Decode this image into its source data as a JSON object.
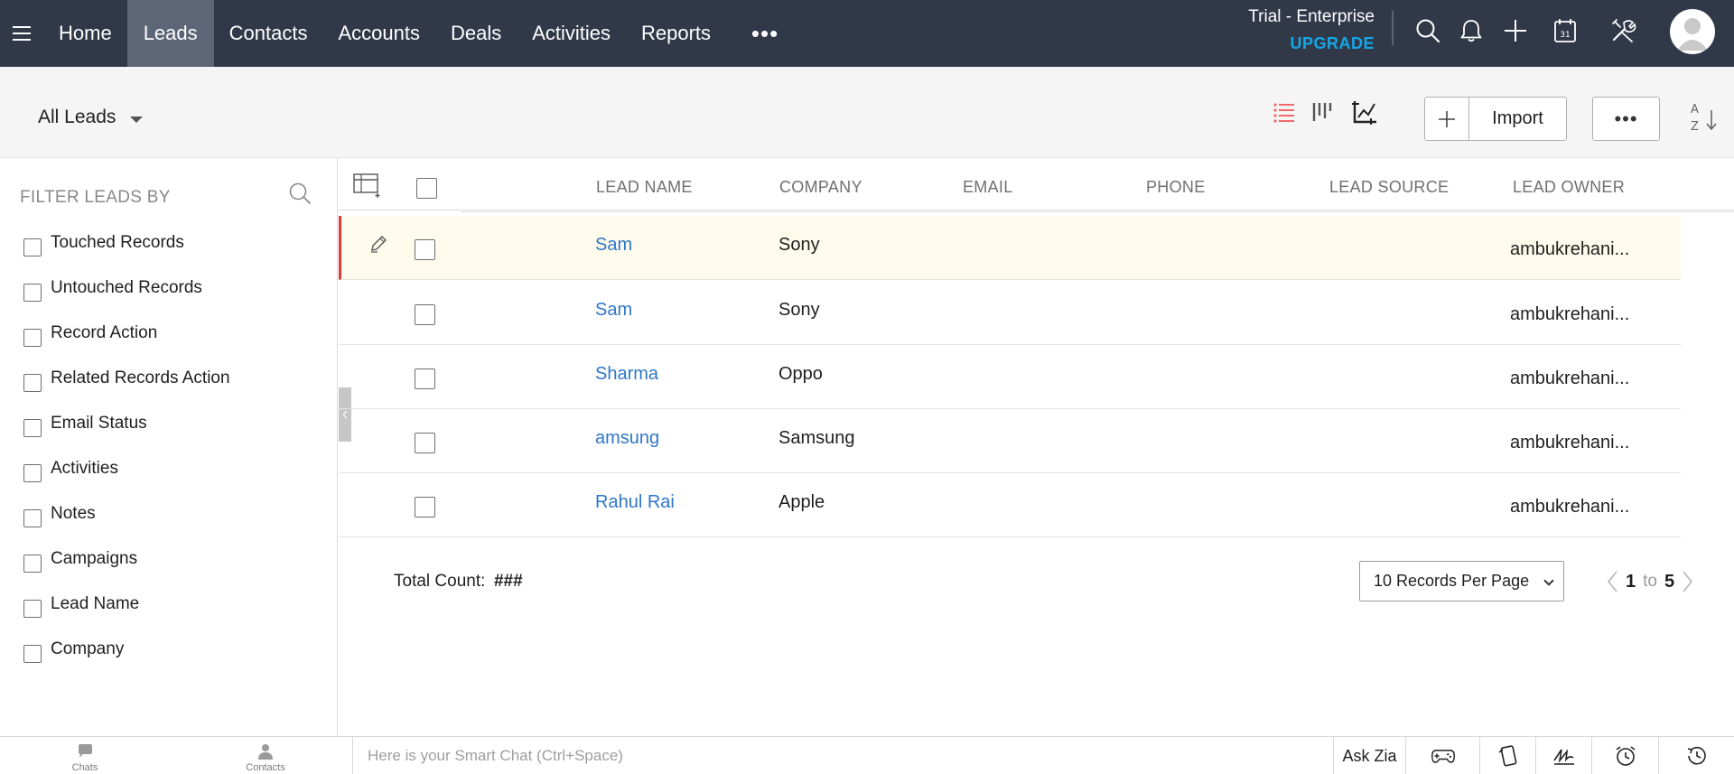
{
  "nav": {
    "tabs": [
      {
        "label": "Home"
      },
      {
        "label": "Leads"
      },
      {
        "label": "Contacts"
      },
      {
        "label": "Accounts"
      },
      {
        "label": "Deals"
      },
      {
        "label": "Activities"
      },
      {
        "label": "Reports"
      }
    ],
    "active_tab": "Leads",
    "more_label": "•••",
    "trial_text": "Trial - Enterprise",
    "upgrade_label": "UPGRADE",
    "calendar_day": "31",
    "icons": [
      "menu-icon",
      "search-icon",
      "bell-icon",
      "plus-icon",
      "calendar-icon",
      "tools-icon",
      "avatar"
    ]
  },
  "subheader": {
    "view_label": "All Leads",
    "import_label": "Import",
    "more_label": "•••",
    "icons": [
      "list-view-icon",
      "kanban-view-icon",
      "chart-view-icon",
      "plus-icon",
      "sort-icon"
    ]
  },
  "filters": {
    "title": "FILTER LEADS BY",
    "items": [
      {
        "label": "Touched Records"
      },
      {
        "label": "Untouched Records"
      },
      {
        "label": "Record Action"
      },
      {
        "label": "Related Records Action"
      },
      {
        "label": "Email Status"
      },
      {
        "label": "Activities"
      },
      {
        "label": "Notes"
      },
      {
        "label": "Campaigns"
      },
      {
        "label": "Lead Name"
      },
      {
        "label": "Company"
      }
    ]
  },
  "table": {
    "columns": [
      "LEAD NAME",
      "COMPANY",
      "EMAIL",
      "PHONE",
      "LEAD SOURCE",
      "LEAD OWNER"
    ],
    "rows": [
      {
        "lead_name": "Sam",
        "company": "Sony",
        "email": "",
        "phone": "",
        "lead_source": "",
        "lead_owner": "ambukrehani..."
      },
      {
        "lead_name": "Sam",
        "company": "Sony",
        "email": "",
        "phone": "",
        "lead_source": "",
        "lead_owner": "ambukrehani..."
      },
      {
        "lead_name": "Sharma",
        "company": "Oppo",
        "email": "",
        "phone": "",
        "lead_source": "",
        "lead_owner": "ambukrehani..."
      },
      {
        "lead_name": "amsung",
        "company": "Samsung",
        "email": "",
        "phone": "",
        "lead_source": "",
        "lead_owner": "ambukrehani..."
      },
      {
        "lead_name": "Rahul Rai",
        "company": "Apple",
        "email": "",
        "phone": "",
        "lead_source": "",
        "lead_owner": "ambukrehani..."
      }
    ],
    "highlighted_row": 1
  },
  "footer": {
    "total_label": "Total Count:",
    "total_value": "###",
    "per_page": "10 Records Per Page",
    "page_from": "1",
    "page_to_label": "to",
    "page_to": "5"
  },
  "bottombar": {
    "chats_label": "Chats",
    "contacts_label": "Contacts",
    "smartchat_placeholder": "Here is your Smart Chat (Ctrl+Space)",
    "askzia_label": "Ask Zia",
    "icons": [
      "chat-icon",
      "contact-icon",
      "gamepad-icon",
      "phone-icon",
      "signature-icon",
      "alarm-icon",
      "history-icon"
    ]
  },
  "colors": {
    "nav_bg": "#313949",
    "nav_active": "#5d6677",
    "upgrade": "#14a7e8",
    "link": "#2e77c7",
    "highlight_row_bg": "#fefbec",
    "highlight_row_border": "#e03b3b",
    "list_view_active": "#f06a6a"
  }
}
